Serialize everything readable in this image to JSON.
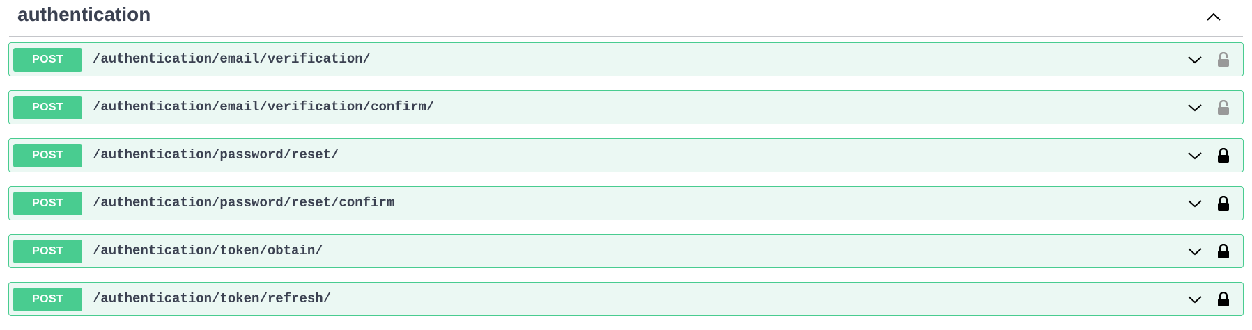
{
  "section": {
    "title": "authentication",
    "toggle_icon": "chevron-up-icon"
  },
  "colors": {
    "post_accent": "#49cc90",
    "post_background": "#ebf8f3",
    "text": "#3b4151",
    "lock_unlocked": "#999999",
    "lock_locked": "#000000"
  },
  "operations": [
    {
      "method": "POST",
      "path": "/authentication/email/verification/",
      "lock": "unlocked"
    },
    {
      "method": "POST",
      "path": "/authentication/email/verification/confirm/",
      "lock": "unlocked"
    },
    {
      "method": "POST",
      "path": "/authentication/password/reset/",
      "lock": "locked"
    },
    {
      "method": "POST",
      "path": "/authentication/password/reset/confirm",
      "lock": "locked"
    },
    {
      "method": "POST",
      "path": "/authentication/token/obtain/",
      "lock": "locked"
    },
    {
      "method": "POST",
      "path": "/authentication/token/refresh/",
      "lock": "locked"
    }
  ]
}
